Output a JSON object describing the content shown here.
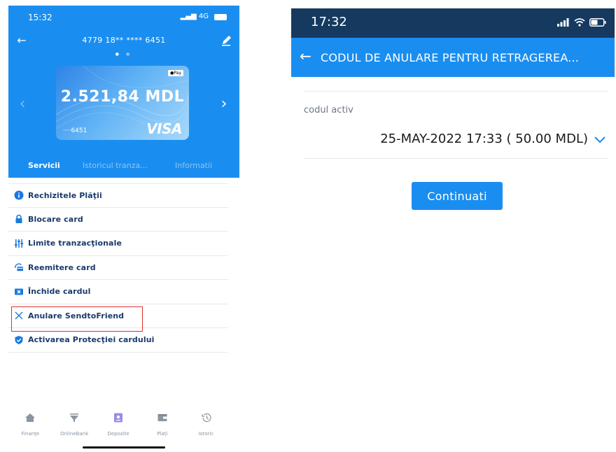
{
  "left_screen": {
    "status": {
      "time": "15:32",
      "network": "4G"
    },
    "header": {
      "card_number": "4779 18** **** 6451"
    },
    "card": {
      "balance": "2.521,84 MDL",
      "last4": "····6451",
      "brand": "VISA",
      "wallet_badge": "Pay"
    },
    "tabs": [
      "Servicii",
      "Istoricul tranza...",
      "Informatii"
    ],
    "menu": [
      {
        "label": "Rechizitele Plăţii",
        "icon": "info-icon"
      },
      {
        "label": "Blocare card",
        "icon": "lock-icon"
      },
      {
        "label": "Limite tranzacţionale",
        "icon": "sliders-icon"
      },
      {
        "label": "Reemitere card",
        "icon": "card-reissue-icon"
      },
      {
        "label": "Închide cardul",
        "icon": "close-box-icon"
      },
      {
        "label": "Anulare SendtoFriend",
        "icon": "x-icon"
      },
      {
        "label": "Activarea Protecţiei cardului",
        "icon": "shield-check-icon"
      }
    ],
    "bottom_nav": [
      {
        "label": "Finanţe",
        "icon": "home-icon"
      },
      {
        "label": "OnlineBank",
        "icon": "funnel-icon"
      },
      {
        "label": "Depozite",
        "icon": "deposit-icon"
      },
      {
        "label": "Plaţi",
        "icon": "wallet-icon"
      },
      {
        "label": "Istoric",
        "icon": "history-icon"
      }
    ]
  },
  "right_screen": {
    "status": {
      "time": "17:32"
    },
    "appbar": {
      "title": "CODUL DE ANULARE PENTRU RETRAGEREA..."
    },
    "field_label": "codul activ",
    "selected_code": "25-MAY-2022 17:33 ( 50.00 MDL)",
    "continue_label": "Continuati"
  },
  "colors": {
    "primary_blue": "#1a8ef0",
    "dark_status": "#163a5f",
    "highlight_red": "#e0312b",
    "menu_text": "#1a3a6b"
  }
}
